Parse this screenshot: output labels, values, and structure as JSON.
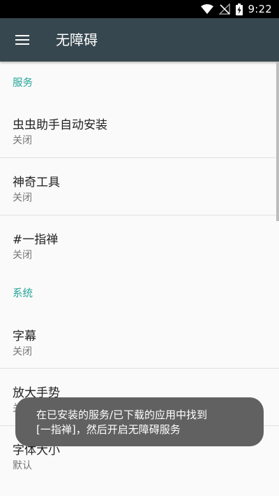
{
  "status_bar": {
    "time": "9:22",
    "icons": [
      "wifi-icon",
      "signal-off-icon",
      "battery-charging-icon"
    ]
  },
  "app_bar": {
    "menu_icon": "menu-icon",
    "title": "无障碍"
  },
  "sections": [
    {
      "header": "服务",
      "items": [
        {
          "title": "虫虫助手自动安装",
          "summary": "关闭"
        },
        {
          "title": "神奇工具",
          "summary": "关闭"
        },
        {
          "title": "#一指禅",
          "summary": "关闭"
        }
      ]
    },
    {
      "header": "系统",
      "items": [
        {
          "title": "字幕",
          "summary": "关闭"
        },
        {
          "title": "放大手势",
          "summary": "关闭"
        },
        {
          "title": "字体大小",
          "summary": "默认"
        }
      ]
    }
  ],
  "toast": {
    "line1": "在已安装的服务/已下载的应用中找到",
    "line2": "[一指禅]，然后开启无障碍服务"
  },
  "colors": {
    "app_bar": "#37474f",
    "accent": "#26a69a",
    "background": "#fafafa",
    "toast_bg": "#616161"
  }
}
